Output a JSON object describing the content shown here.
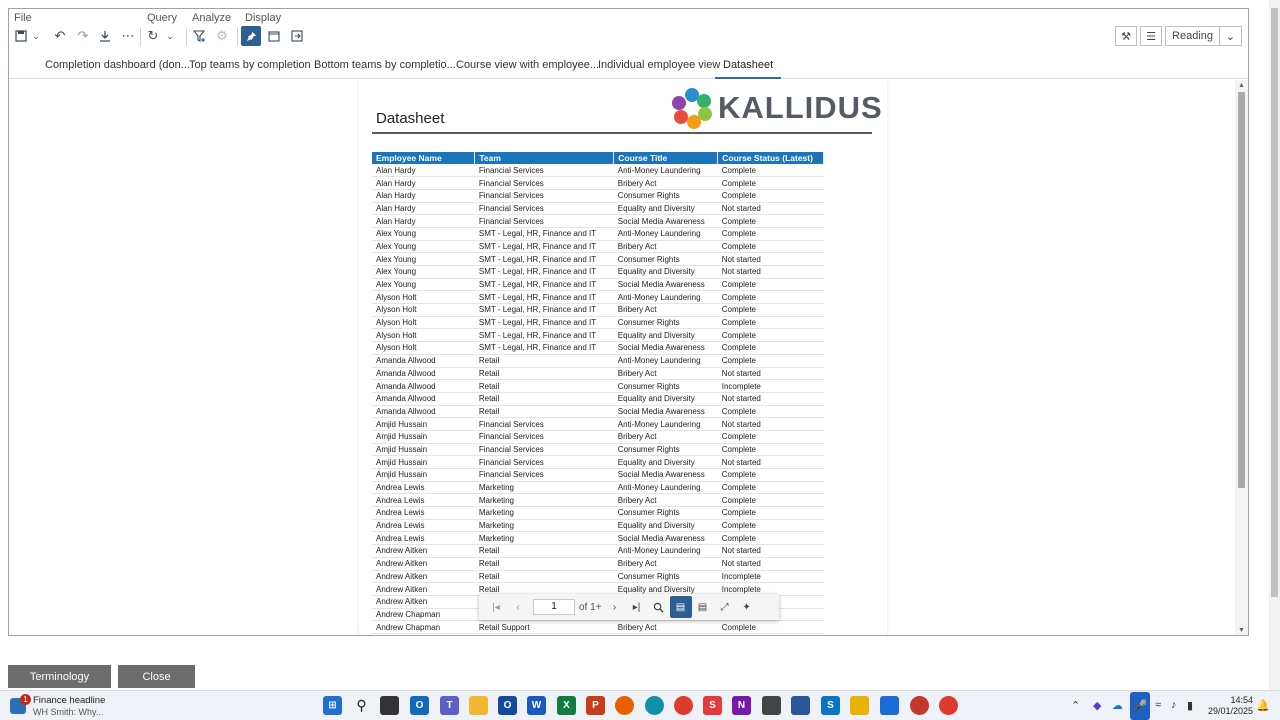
{
  "menu": {
    "file": "File",
    "query": "Query",
    "analyze": "Analyze",
    "display": "Display"
  },
  "toolbar": {
    "reading_label": "Reading"
  },
  "tabs": [
    "Completion dashboard (don...",
    "Top teams by completion",
    "Bottom teams by completio...",
    "Course view with employee...",
    "Individual employee view",
    "Datasheet"
  ],
  "report": {
    "title": "Datasheet",
    "logo_text": "KALLIDUS",
    "columns": [
      "Employee Name",
      "Team",
      "Course Title",
      "Course Status (Latest)"
    ],
    "rows": [
      [
        "Alan Hardy",
        "Financial Services",
        "Anti-Money Laundering",
        "Complete"
      ],
      [
        "Alan Hardy",
        "Financial Services",
        "Bribery Act",
        "Complete"
      ],
      [
        "Alan Hardy",
        "Financial Services",
        "Consumer Rights",
        "Complete"
      ],
      [
        "Alan Hardy",
        "Financial Services",
        "Equality and Diversity",
        "Not started"
      ],
      [
        "Alan Hardy",
        "Financial Services",
        "Social Media Awareness",
        "Complete"
      ],
      [
        "Alex Young",
        "SMT - Legal, HR, Finance and IT",
        "Anti-Money Laundering",
        "Complete"
      ],
      [
        "Alex Young",
        "SMT - Legal, HR, Finance and IT",
        "Bribery Act",
        "Complete"
      ],
      [
        "Alex Young",
        "SMT - Legal, HR, Finance and IT",
        "Consumer Rights",
        "Not started"
      ],
      [
        "Alex Young",
        "SMT - Legal, HR, Finance and IT",
        "Equality and Diversity",
        "Not started"
      ],
      [
        "Alex Young",
        "SMT - Legal, HR, Finance and IT",
        "Social Media Awareness",
        "Complete"
      ],
      [
        "Alyson Holt",
        "SMT - Legal, HR, Finance and IT",
        "Anti-Money Laundering",
        "Complete"
      ],
      [
        "Alyson Holt",
        "SMT - Legal, HR, Finance and IT",
        "Bribery Act",
        "Complete"
      ],
      [
        "Alyson Holt",
        "SMT - Legal, HR, Finance and IT",
        "Consumer Rights",
        "Complete"
      ],
      [
        "Alyson Holt",
        "SMT - Legal, HR, Finance and IT",
        "Equality and Diversity",
        "Complete"
      ],
      [
        "Alyson Holt",
        "SMT - Legal, HR, Finance and IT",
        "Social Media Awareness",
        "Complete"
      ],
      [
        "Amanda Allwood",
        "Retail",
        "Anti-Money Laundering",
        "Complete"
      ],
      [
        "Amanda Allwood",
        "Retail",
        "Bribery Act",
        "Not started"
      ],
      [
        "Amanda Allwood",
        "Retail",
        "Consumer Rights",
        "Incomplete"
      ],
      [
        "Amanda Allwood",
        "Retail",
        "Equality and Diversity",
        "Not started"
      ],
      [
        "Amanda Allwood",
        "Retail",
        "Social Media Awareness",
        "Complete"
      ],
      [
        "Amjid Hussain",
        "Financial Services",
        "Anti-Money Laundering",
        "Not started"
      ],
      [
        "Amjid Hussain",
        "Financial Services",
        "Bribery Act",
        "Complete"
      ],
      [
        "Amjid Hussain",
        "Financial Services",
        "Consumer Rights",
        "Complete"
      ],
      [
        "Amjid Hussain",
        "Financial Services",
        "Equality and Diversity",
        "Not started"
      ],
      [
        "Amjid Hussain",
        "Financial Services",
        "Social Media Awareness",
        "Complete"
      ],
      [
        "Andrea Lewis",
        "Marketing",
        "Anti-Money Laundering",
        "Complete"
      ],
      [
        "Andrea Lewis",
        "Marketing",
        "Bribery Act",
        "Complete"
      ],
      [
        "Andrea Lewis",
        "Marketing",
        "Consumer Rights",
        "Complete"
      ],
      [
        "Andrea Lewis",
        "Marketing",
        "Equality and Diversity",
        "Complete"
      ],
      [
        "Andrea Lewis",
        "Marketing",
        "Social Media Awareness",
        "Complete"
      ],
      [
        "Andrew Aitken",
        "Retail",
        "Anti-Money Laundering",
        "Not started"
      ],
      [
        "Andrew Aitken",
        "Retail",
        "Bribery Act",
        "Not started"
      ],
      [
        "Andrew Aitken",
        "Retail",
        "Consumer Rights",
        "Incomplete"
      ],
      [
        "Andrew Aitken",
        "Retail",
        "Equality and Diversity",
        "Incomplete"
      ],
      [
        "Andrew Aitken",
        "",
        "",
        ""
      ],
      [
        "Andrew Chapman",
        "",
        "",
        ""
      ],
      [
        "Andrew Chapman",
        "Retail Support",
        "Bribery Act",
        "Complete"
      ]
    ]
  },
  "pager": {
    "current_page": "1",
    "of_label": "of 1+"
  },
  "bottom": {
    "terminology": "Terminology",
    "close": "Close"
  },
  "taskbar": {
    "news_headline": "Finance headline",
    "news_sub": "WH Smith: Why...",
    "news_badge": "1",
    "time": "14:54",
    "date": "29/01/2025"
  }
}
